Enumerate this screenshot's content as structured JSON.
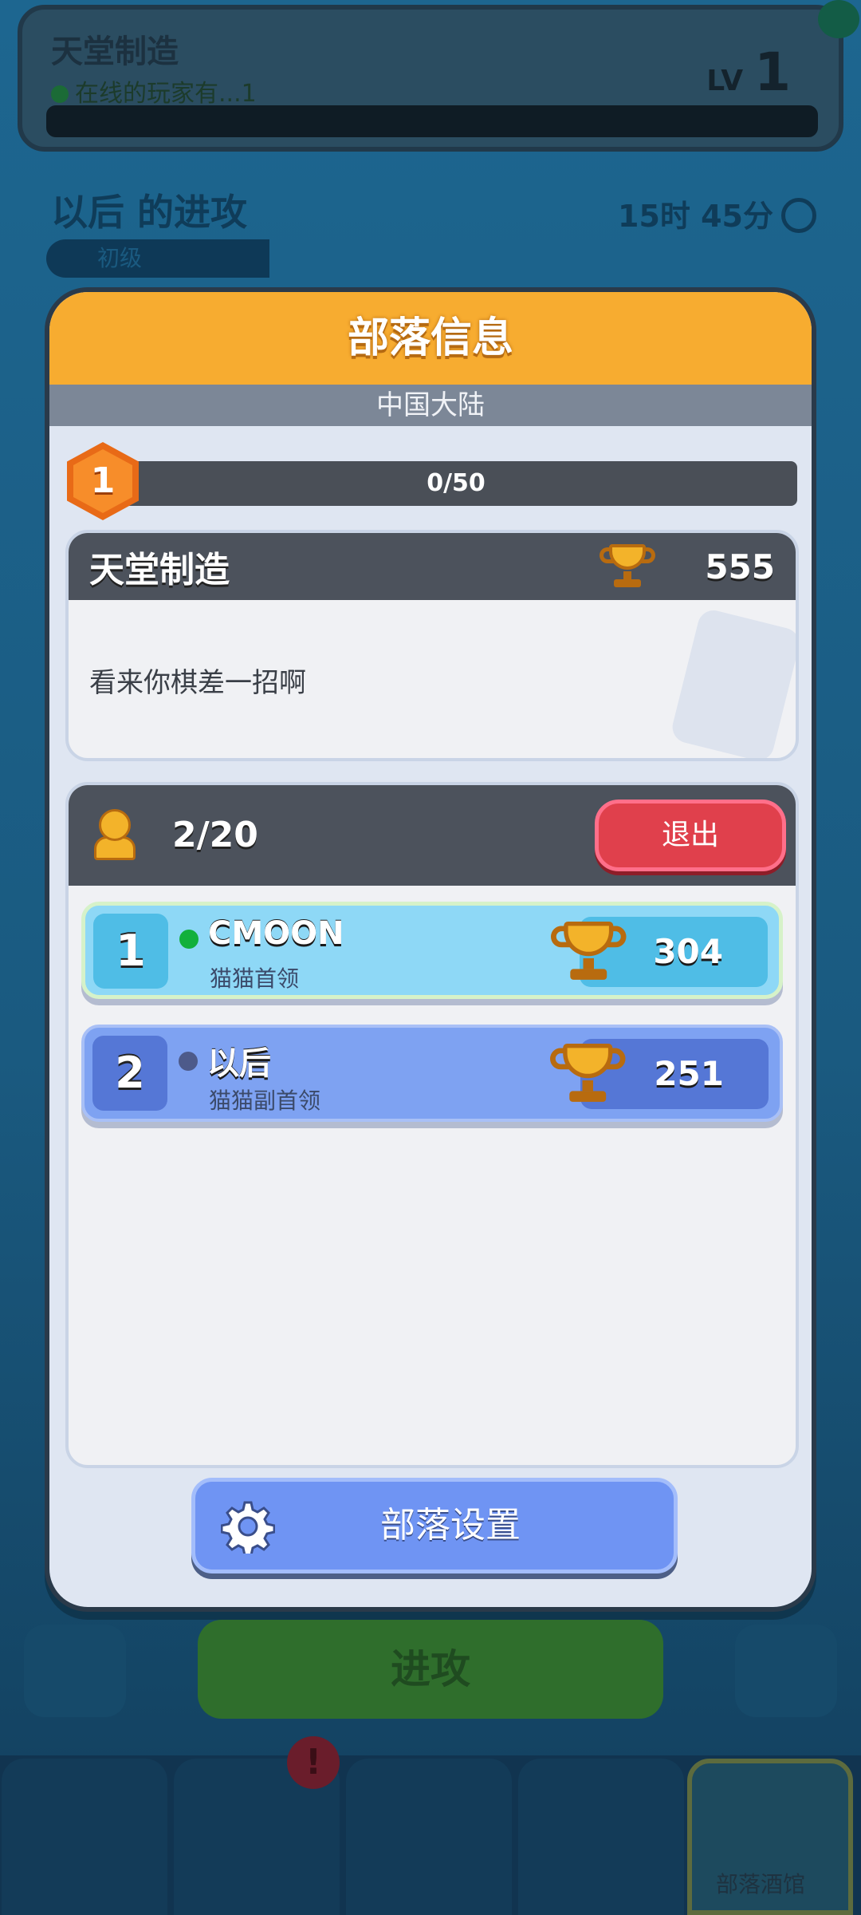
{
  "background": {
    "top_card": {
      "title": "天堂制造",
      "online_text": "在线的玩家有...1",
      "lv_label": "LV",
      "lv_value": "1"
    },
    "next_attack": "以后 的进攻",
    "timer": "15时 45分",
    "tier": "初级",
    "attack_button": "进攻",
    "nav_active_label": "部落酒馆"
  },
  "dialog": {
    "title": "部落信息",
    "region": "中国大陆",
    "clan_level": "1",
    "progress_text": "0/50",
    "clan": {
      "name": "天堂制造",
      "trophies": "555",
      "description": "看来你棋差一招啊"
    },
    "members": {
      "count": "2/20",
      "leave_label": "退出",
      "rows": [
        {
          "rank": "1",
          "name": "CMOON",
          "role": "猫猫首领",
          "trophies": "304",
          "online": true
        },
        {
          "rank": "2",
          "name": "以后",
          "role": "猫猫副首领",
          "trophies": "251",
          "online": false
        }
      ]
    },
    "settings_label": "部落设置"
  },
  "colors": {
    "header": "#f7ac30",
    "online": "#12b03c",
    "leave": "#e0404c",
    "settings": "#6f94f3"
  }
}
